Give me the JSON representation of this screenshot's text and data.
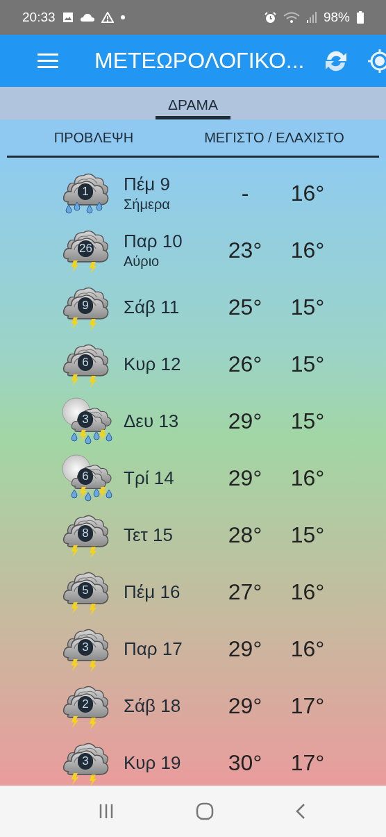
{
  "status_bar": {
    "time": "20:33",
    "battery": "98%"
  },
  "app_bar": {
    "title": "ΜΕΤΕΩΡΟΛΟΓΙΚΟ..."
  },
  "tabs": [
    {
      "label": "ΔΡΑΜΑ",
      "selected": true
    }
  ],
  "columns": [
    "ΠΡΟΒΛΕΨΗ",
    "ΜΕΓΙΣΤΟ / ΕΛΑΧΙΣΤΟ"
  ],
  "days": [
    {
      "kind": "rain",
      "badge": "1",
      "day": "Πέμ 9",
      "note": "Σήμερα",
      "max": "-",
      "min": "16°"
    },
    {
      "kind": "storm",
      "badge": "26",
      "day": "Παρ 10",
      "note": "Αύριο",
      "max": "23°",
      "min": "16°"
    },
    {
      "kind": "storm",
      "badge": "9",
      "day": "Σάβ 11",
      "max": "25°",
      "min": "15°"
    },
    {
      "kind": "storm",
      "badge": "6",
      "day": "Κυρ 12",
      "max": "26°",
      "min": "15°"
    },
    {
      "kind": "moon-storm",
      "badge": "3",
      "day": "Δευ 13",
      "max": "29°",
      "min": "15°"
    },
    {
      "kind": "moon-storm",
      "badge": "6",
      "day": "Τρί 14",
      "max": "29°",
      "min": "16°"
    },
    {
      "kind": "storm",
      "badge": "8",
      "day": "Τετ 15",
      "max": "28°",
      "min": "15°"
    },
    {
      "kind": "storm",
      "badge": "5",
      "day": "Πέμ 16",
      "max": "27°",
      "min": "16°"
    },
    {
      "kind": "storm",
      "badge": "3",
      "day": "Παρ 17",
      "max": "29°",
      "min": "16°"
    },
    {
      "kind": "storm",
      "badge": "2",
      "day": "Σάβ 18",
      "max": "29°",
      "min": "17°"
    },
    {
      "kind": "storm",
      "badge": "3",
      "day": "Κυρ 19",
      "max": "30°",
      "min": "17°"
    }
  ]
}
